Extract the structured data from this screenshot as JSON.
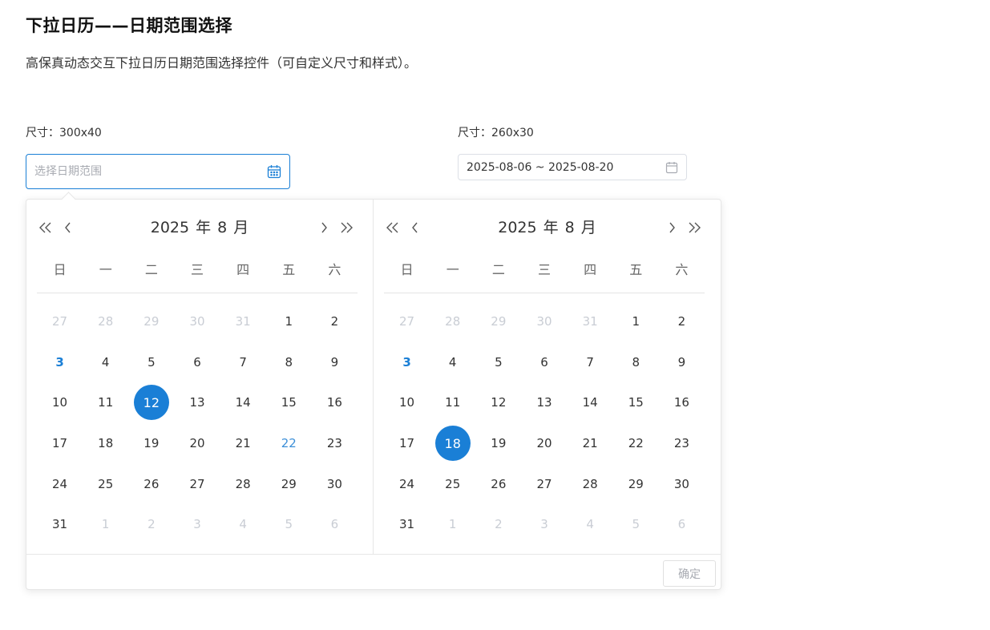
{
  "page": {
    "title": "下拉日历——日期范围选择",
    "description": "高保真动态交互下拉日历日期范围选择控件（可自定义尺寸和样式）。"
  },
  "pickers": [
    {
      "size_label": "尺寸：300x40",
      "placeholder": "选择日期范围",
      "value": "",
      "state": "focused",
      "icon": "calendar-icon"
    },
    {
      "size_label": "尺寸：260x30",
      "placeholder": "",
      "value": "2025-08-06 ~ 2025-08-20",
      "state": "idle",
      "icon": "calendar-icon"
    }
  ],
  "popup": {
    "weekdays": [
      "日",
      "一",
      "二",
      "三",
      "四",
      "五",
      "六"
    ],
    "confirm_label": "确定",
    "confirm_disabled": true,
    "accent_color": "#1a7fd6",
    "panels": [
      {
        "year": "2025",
        "year_unit": "年",
        "month": "8",
        "month_unit": "月",
        "days": [
          {
            "d": "27",
            "other": true
          },
          {
            "d": "28",
            "other": true
          },
          {
            "d": "29",
            "other": true
          },
          {
            "d": "30",
            "other": true
          },
          {
            "d": "31",
            "other": true
          },
          {
            "d": "1"
          },
          {
            "d": "2"
          },
          {
            "d": "3",
            "today": true
          },
          {
            "d": "4"
          },
          {
            "d": "5"
          },
          {
            "d": "6"
          },
          {
            "d": "7"
          },
          {
            "d": "8"
          },
          {
            "d": "9"
          },
          {
            "d": "10"
          },
          {
            "d": "11"
          },
          {
            "d": "12",
            "selected": true
          },
          {
            "d": "13"
          },
          {
            "d": "14"
          },
          {
            "d": "15"
          },
          {
            "d": "16"
          },
          {
            "d": "17"
          },
          {
            "d": "18"
          },
          {
            "d": "19"
          },
          {
            "d": "20"
          },
          {
            "d": "21"
          },
          {
            "d": "22",
            "hover": true
          },
          {
            "d": "23"
          },
          {
            "d": "24"
          },
          {
            "d": "25"
          },
          {
            "d": "26"
          },
          {
            "d": "27"
          },
          {
            "d": "28"
          },
          {
            "d": "29"
          },
          {
            "d": "30"
          },
          {
            "d": "31"
          },
          {
            "d": "1",
            "other": true
          },
          {
            "d": "2",
            "other": true
          },
          {
            "d": "3",
            "other": true
          },
          {
            "d": "4",
            "other": true
          },
          {
            "d": "5",
            "other": true
          },
          {
            "d": "6",
            "other": true
          }
        ]
      },
      {
        "year": "2025",
        "year_unit": "年",
        "month": "8",
        "month_unit": "月",
        "days": [
          {
            "d": "27",
            "other": true
          },
          {
            "d": "28",
            "other": true
          },
          {
            "d": "29",
            "other": true
          },
          {
            "d": "30",
            "other": true
          },
          {
            "d": "31",
            "other": true
          },
          {
            "d": "1"
          },
          {
            "d": "2"
          },
          {
            "d": "3",
            "today": true
          },
          {
            "d": "4"
          },
          {
            "d": "5"
          },
          {
            "d": "6"
          },
          {
            "d": "7"
          },
          {
            "d": "8"
          },
          {
            "d": "9"
          },
          {
            "d": "10"
          },
          {
            "d": "11"
          },
          {
            "d": "12"
          },
          {
            "d": "13"
          },
          {
            "d": "14"
          },
          {
            "d": "15"
          },
          {
            "d": "16"
          },
          {
            "d": "17"
          },
          {
            "d": "18",
            "selected": true
          },
          {
            "d": "19"
          },
          {
            "d": "20"
          },
          {
            "d": "21"
          },
          {
            "d": "22"
          },
          {
            "d": "23"
          },
          {
            "d": "24"
          },
          {
            "d": "25"
          },
          {
            "d": "26"
          },
          {
            "d": "27"
          },
          {
            "d": "28"
          },
          {
            "d": "29"
          },
          {
            "d": "30"
          },
          {
            "d": "31"
          },
          {
            "d": "1",
            "other": true
          },
          {
            "d": "2",
            "other": true
          },
          {
            "d": "3",
            "other": true
          },
          {
            "d": "4",
            "other": true
          },
          {
            "d": "5",
            "other": true
          },
          {
            "d": "6",
            "other": true
          }
        ]
      }
    ]
  }
}
